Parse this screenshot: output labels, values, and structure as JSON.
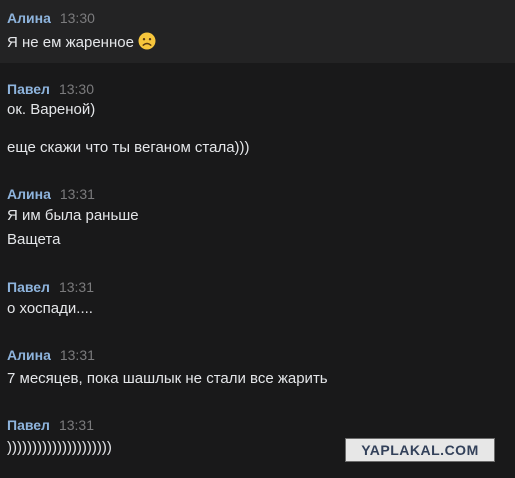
{
  "messages": [
    {
      "author": "Алина",
      "time": "13:30",
      "lines": [
        "Я не ем жаренное"
      ],
      "emoji": "frowning-face"
    },
    {
      "author": "Павел",
      "time": "13:30",
      "lines": [
        "ок. Вареной)",
        "еще скажи что ты веганом стала)))"
      ]
    },
    {
      "author": "Алина",
      "time": "13:31",
      "lines": [
        "Я им была раньше",
        "Ващета"
      ]
    },
    {
      "author": "Павел",
      "time": "13:31",
      "lines": [
        "о хоспади...."
      ]
    },
    {
      "author": "Алина",
      "time": "13:31",
      "lines": [
        "7 месяцев, пока шашлык не стали все жарить"
      ]
    },
    {
      "author": "Павел",
      "time": "13:31",
      "lines": [
        ")))))))))))))))))))))"
      ]
    }
  ],
  "watermark": "YAPLAKAL.COM",
  "colors": {
    "background": "#19191a",
    "highlight": "#232324",
    "author": "#8eb4dd",
    "time": "#7b7b7d",
    "text": "#e4e6e9"
  }
}
